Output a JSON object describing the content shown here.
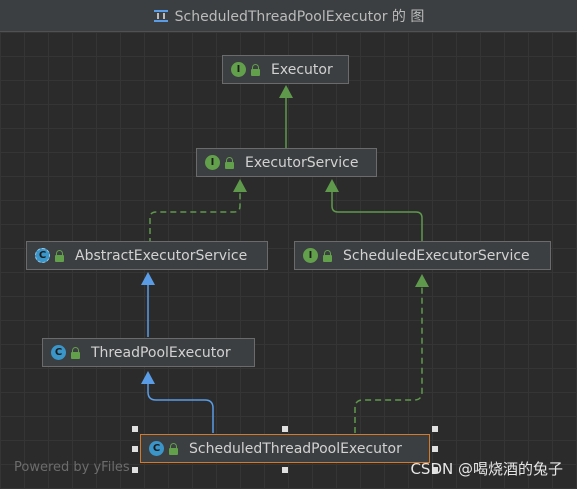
{
  "window": {
    "title": "ScheduledThreadPoolExecutor 的 图",
    "title_icon": "diagram-icon"
  },
  "diagram": {
    "nodes": {
      "executor": {
        "label": "Executor",
        "kind": "interface"
      },
      "executor_service": {
        "label": "ExecutorService",
        "kind": "interface"
      },
      "abstract_executor_service": {
        "label": "AbstractExecutorService",
        "kind": "abstract-class"
      },
      "scheduled_executor_service": {
        "label": "ScheduledExecutorService",
        "kind": "interface"
      },
      "thread_pool_executor": {
        "label": "ThreadPoolExecutor",
        "kind": "class"
      },
      "scheduled_thread_pool_executor": {
        "label": "ScheduledThreadPoolExecutor",
        "kind": "class",
        "selected": true
      }
    },
    "badges": {
      "interface": "I",
      "class": "C",
      "abstract": "C"
    },
    "edges": [
      {
        "from": "executor_service",
        "to": "executor",
        "type": "extends"
      },
      {
        "from": "abstract_executor_service",
        "to": "executor_service",
        "type": "implements"
      },
      {
        "from": "scheduled_executor_service",
        "to": "executor_service",
        "type": "extends"
      },
      {
        "from": "thread_pool_executor",
        "to": "abstract_executor_service",
        "type": "extends"
      },
      {
        "from": "scheduled_thread_pool_executor",
        "to": "thread_pool_executor",
        "type": "extends"
      },
      {
        "from": "scheduled_thread_pool_executor",
        "to": "scheduled_executor_service",
        "type": "implements"
      }
    ],
    "colors": {
      "interface_edge": "#5f9a4c",
      "class_edge": "#5a9de6",
      "selection_border": "#d3792b",
      "background": "#2b2b2b"
    }
  },
  "footer": {
    "powered_by": "Powered by yFiles",
    "watermark": "CSDN @喝烧酒的兔子"
  }
}
